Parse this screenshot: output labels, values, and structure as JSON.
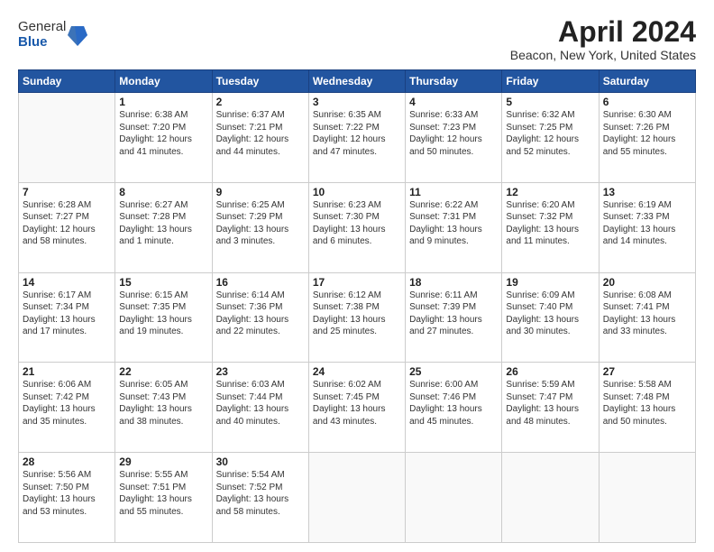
{
  "logo": {
    "general": "General",
    "blue": "Blue"
  },
  "title": "April 2024",
  "subtitle": "Beacon, New York, United States",
  "weekdays": [
    "Sunday",
    "Monday",
    "Tuesday",
    "Wednesday",
    "Thursday",
    "Friday",
    "Saturday"
  ],
  "weeks": [
    [
      {
        "day": "",
        "empty": true
      },
      {
        "day": "1",
        "sunrise": "Sunrise: 6:38 AM",
        "sunset": "Sunset: 7:20 PM",
        "daylight": "Daylight: 12 hours and 41 minutes."
      },
      {
        "day": "2",
        "sunrise": "Sunrise: 6:37 AM",
        "sunset": "Sunset: 7:21 PM",
        "daylight": "Daylight: 12 hours and 44 minutes."
      },
      {
        "day": "3",
        "sunrise": "Sunrise: 6:35 AM",
        "sunset": "Sunset: 7:22 PM",
        "daylight": "Daylight: 12 hours and 47 minutes."
      },
      {
        "day": "4",
        "sunrise": "Sunrise: 6:33 AM",
        "sunset": "Sunset: 7:23 PM",
        "daylight": "Daylight: 12 hours and 50 minutes."
      },
      {
        "day": "5",
        "sunrise": "Sunrise: 6:32 AM",
        "sunset": "Sunset: 7:25 PM",
        "daylight": "Daylight: 12 hours and 52 minutes."
      },
      {
        "day": "6",
        "sunrise": "Sunrise: 6:30 AM",
        "sunset": "Sunset: 7:26 PM",
        "daylight": "Daylight: 12 hours and 55 minutes."
      }
    ],
    [
      {
        "day": "7",
        "sunrise": "Sunrise: 6:28 AM",
        "sunset": "Sunset: 7:27 PM",
        "daylight": "Daylight: 12 hours and 58 minutes."
      },
      {
        "day": "8",
        "sunrise": "Sunrise: 6:27 AM",
        "sunset": "Sunset: 7:28 PM",
        "daylight": "Daylight: 13 hours and 1 minute."
      },
      {
        "day": "9",
        "sunrise": "Sunrise: 6:25 AM",
        "sunset": "Sunset: 7:29 PM",
        "daylight": "Daylight: 13 hours and 3 minutes."
      },
      {
        "day": "10",
        "sunrise": "Sunrise: 6:23 AM",
        "sunset": "Sunset: 7:30 PM",
        "daylight": "Daylight: 13 hours and 6 minutes."
      },
      {
        "day": "11",
        "sunrise": "Sunrise: 6:22 AM",
        "sunset": "Sunset: 7:31 PM",
        "daylight": "Daylight: 13 hours and 9 minutes."
      },
      {
        "day": "12",
        "sunrise": "Sunrise: 6:20 AM",
        "sunset": "Sunset: 7:32 PM",
        "daylight": "Daylight: 13 hours and 11 minutes."
      },
      {
        "day": "13",
        "sunrise": "Sunrise: 6:19 AM",
        "sunset": "Sunset: 7:33 PM",
        "daylight": "Daylight: 13 hours and 14 minutes."
      }
    ],
    [
      {
        "day": "14",
        "sunrise": "Sunrise: 6:17 AM",
        "sunset": "Sunset: 7:34 PM",
        "daylight": "Daylight: 13 hours and 17 minutes."
      },
      {
        "day": "15",
        "sunrise": "Sunrise: 6:15 AM",
        "sunset": "Sunset: 7:35 PM",
        "daylight": "Daylight: 13 hours and 19 minutes."
      },
      {
        "day": "16",
        "sunrise": "Sunrise: 6:14 AM",
        "sunset": "Sunset: 7:36 PM",
        "daylight": "Daylight: 13 hours and 22 minutes."
      },
      {
        "day": "17",
        "sunrise": "Sunrise: 6:12 AM",
        "sunset": "Sunset: 7:38 PM",
        "daylight": "Daylight: 13 hours and 25 minutes."
      },
      {
        "day": "18",
        "sunrise": "Sunrise: 6:11 AM",
        "sunset": "Sunset: 7:39 PM",
        "daylight": "Daylight: 13 hours and 27 minutes."
      },
      {
        "day": "19",
        "sunrise": "Sunrise: 6:09 AM",
        "sunset": "Sunset: 7:40 PM",
        "daylight": "Daylight: 13 hours and 30 minutes."
      },
      {
        "day": "20",
        "sunrise": "Sunrise: 6:08 AM",
        "sunset": "Sunset: 7:41 PM",
        "daylight": "Daylight: 13 hours and 33 minutes."
      }
    ],
    [
      {
        "day": "21",
        "sunrise": "Sunrise: 6:06 AM",
        "sunset": "Sunset: 7:42 PM",
        "daylight": "Daylight: 13 hours and 35 minutes."
      },
      {
        "day": "22",
        "sunrise": "Sunrise: 6:05 AM",
        "sunset": "Sunset: 7:43 PM",
        "daylight": "Daylight: 13 hours and 38 minutes."
      },
      {
        "day": "23",
        "sunrise": "Sunrise: 6:03 AM",
        "sunset": "Sunset: 7:44 PM",
        "daylight": "Daylight: 13 hours and 40 minutes."
      },
      {
        "day": "24",
        "sunrise": "Sunrise: 6:02 AM",
        "sunset": "Sunset: 7:45 PM",
        "daylight": "Daylight: 13 hours and 43 minutes."
      },
      {
        "day": "25",
        "sunrise": "Sunrise: 6:00 AM",
        "sunset": "Sunset: 7:46 PM",
        "daylight": "Daylight: 13 hours and 45 minutes."
      },
      {
        "day": "26",
        "sunrise": "Sunrise: 5:59 AM",
        "sunset": "Sunset: 7:47 PM",
        "daylight": "Daylight: 13 hours and 48 minutes."
      },
      {
        "day": "27",
        "sunrise": "Sunrise: 5:58 AM",
        "sunset": "Sunset: 7:48 PM",
        "daylight": "Daylight: 13 hours and 50 minutes."
      }
    ],
    [
      {
        "day": "28",
        "sunrise": "Sunrise: 5:56 AM",
        "sunset": "Sunset: 7:50 PM",
        "daylight": "Daylight: 13 hours and 53 minutes."
      },
      {
        "day": "29",
        "sunrise": "Sunrise: 5:55 AM",
        "sunset": "Sunset: 7:51 PM",
        "daylight": "Daylight: 13 hours and 55 minutes."
      },
      {
        "day": "30",
        "sunrise": "Sunrise: 5:54 AM",
        "sunset": "Sunset: 7:52 PM",
        "daylight": "Daylight: 13 hours and 58 minutes."
      },
      {
        "day": "",
        "empty": true
      },
      {
        "day": "",
        "empty": true
      },
      {
        "day": "",
        "empty": true
      },
      {
        "day": "",
        "empty": true
      }
    ]
  ]
}
